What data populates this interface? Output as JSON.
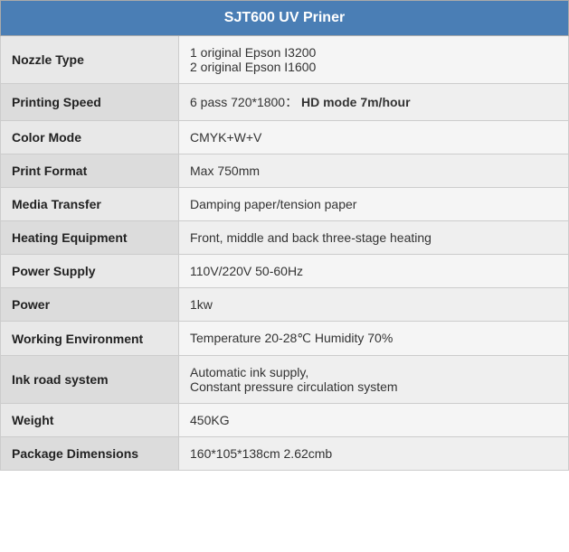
{
  "header": {
    "title": "SJT600 UV Priner"
  },
  "rows": [
    {
      "label": "Nozzle Type",
      "value_plain": "1 original Epson I3200\n2 original Epson I1600",
      "value_parts": [
        {
          "text": "1 original Epson I3200",
          "bold": false
        },
        {
          "text": "2 original Epson I1600",
          "bold": false
        }
      ],
      "multiline": true
    },
    {
      "label": "Printing Speed",
      "value_plain": "6 pass 720*1800： HD mode 7m/hour",
      "value_parts": [
        {
          "text": "6 pass 720*1800：",
          "bold": false
        },
        {
          "text": " HD mode 7m/hour",
          "bold": true
        }
      ],
      "multiline": false
    },
    {
      "label": "Color Mode",
      "value_plain": "CMYK+W+V",
      "multiline": false
    },
    {
      "label": "Print Format",
      "value_plain": "Max 750mm",
      "multiline": false
    },
    {
      "label": "Media Transfer",
      "value_plain": "Damping paper/tension paper",
      "multiline": false
    },
    {
      "label": "Heating Equipment",
      "value_plain": "Front, middle and back three-stage heating",
      "multiline": false
    },
    {
      "label": "Power Supply",
      "value_plain": "110V/220V 50-60Hz",
      "multiline": false
    },
    {
      "label": "Power",
      "value_plain": "1kw",
      "multiline": false
    },
    {
      "label": "Working Environment",
      "value_plain": "Temperature 20-28℃ Humidity 70%",
      "multiline": false
    },
    {
      "label": "Ink road system",
      "value_plain": "Automatic ink supply,\nConstant pressure circulation system",
      "multiline": true,
      "value_parts": [
        {
          "text": "Automatic ink supply,",
          "bold": false
        },
        {
          "text": "Constant pressure circulation system",
          "bold": false
        }
      ]
    },
    {
      "label": "Weight",
      "value_plain": "450KG",
      "multiline": false
    },
    {
      "label": "Package Dimensions",
      "value_plain": "160*105*138cm 2.62cmb",
      "multiline": false
    }
  ]
}
